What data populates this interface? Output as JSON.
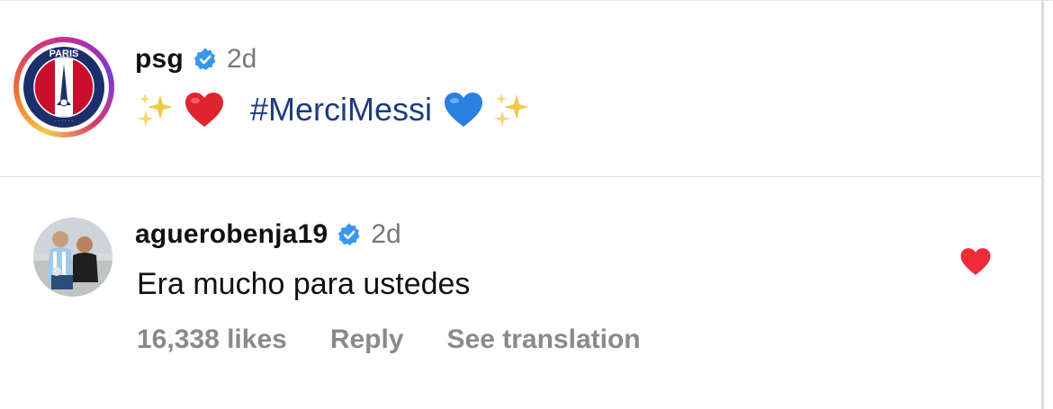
{
  "post": {
    "username": "psg",
    "age": "2d",
    "hashtag": "#MerciMessi",
    "caption_emojis": [
      "sparkles-icon",
      "red-heart-icon",
      "blue-heart-icon",
      "sparkles-icon"
    ],
    "avatar_text": "PARIS"
  },
  "comment": {
    "username": "aguerobenja19",
    "age": "2d",
    "text": "Era mucho para ustedes",
    "likes": "16,338 likes",
    "reply_label": "Reply",
    "translation_label": "See translation",
    "liked": true
  },
  "colors": {
    "verified": "#3897f0",
    "like_heart": "#ed2b3a",
    "hashtag": "#1d3b82",
    "secondary_text": "#8a8a8a"
  }
}
